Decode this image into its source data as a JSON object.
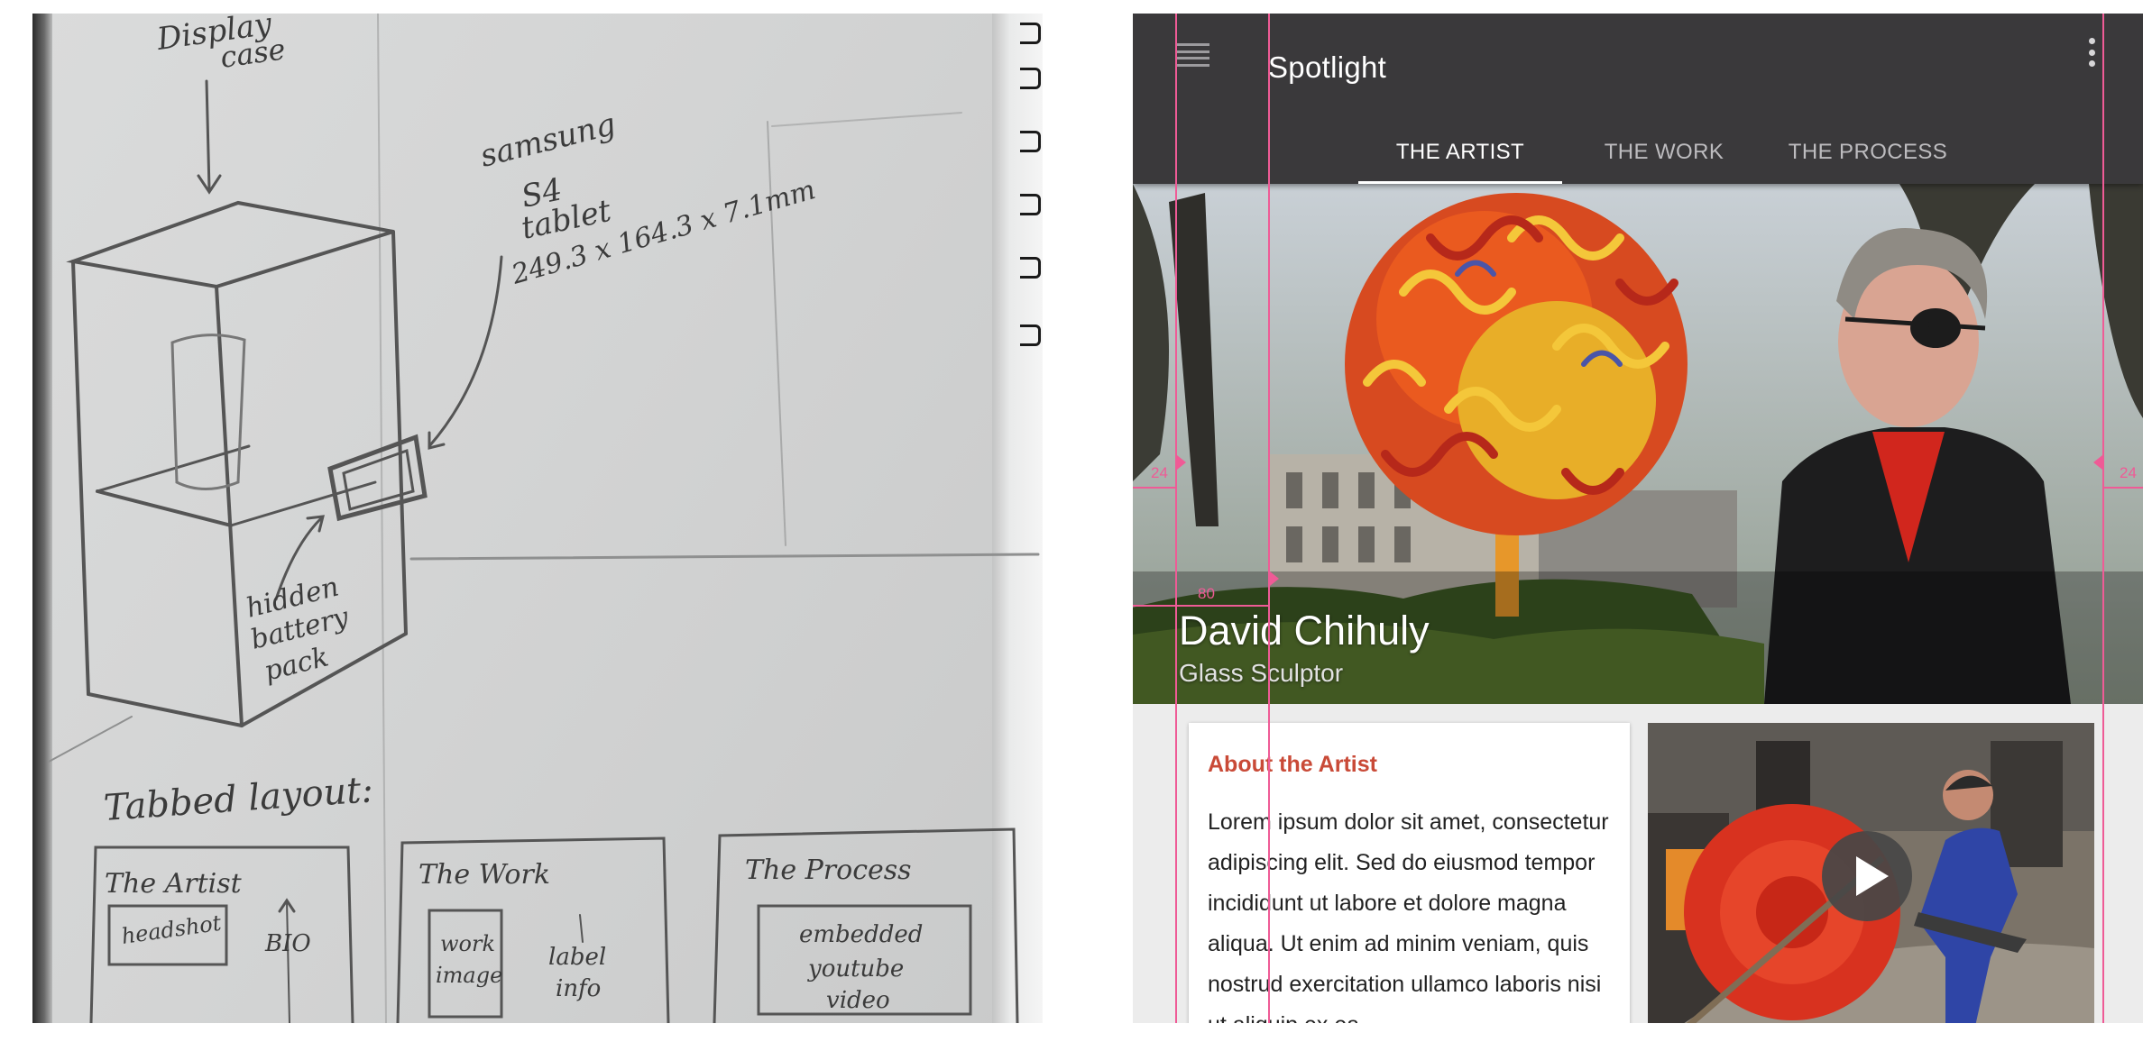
{
  "sketch": {
    "annotations": {
      "display_case_1": "Display",
      "display_case_2": "case",
      "tablet_1": "samsung",
      "tablet_2": "S4",
      "tablet_3": "tablet",
      "tablet_dims": "249.3 x 164.3 x 7.1mm",
      "battery_1": "hidden",
      "battery_2": "battery",
      "battery_3": "pack",
      "tabbed_layout": "Tabbed layout:"
    },
    "wireframes": [
      {
        "heading": "The Artist",
        "box": "headshot",
        "note": "BIO"
      },
      {
        "heading": "The Work",
        "box_1": "work",
        "box_2": "image",
        "note_1": "label",
        "note_2": "info"
      },
      {
        "heading": "The Process",
        "box_1": "embedded",
        "box_2": "youtube",
        "box_3": "video"
      }
    ]
  },
  "app": {
    "title": "Spotlight",
    "icons": {
      "menu": "menu-icon",
      "overflow": "more-vert-icon",
      "play": "play-icon"
    },
    "tabs": [
      {
        "label": "THE ARTIST",
        "active": true
      },
      {
        "label": "THE WORK",
        "active": false
      },
      {
        "label": "THE PROCESS",
        "active": false
      }
    ],
    "hero": {
      "name": "David Chihuly",
      "role": "Glass Sculptor"
    },
    "about": {
      "title": "About the Artist",
      "body": "Lorem ipsum dolor sit amet, consectetur adipiscing elit. Sed do eiusmod tempor incididunt ut labore et dolore magna aliqua. Ut enim ad minim veniam, quis nostrud exercitation ullamco laboris nisi ut aliquip ex ea"
    },
    "keylines": {
      "left_margin": "24",
      "right_margin": "24",
      "content_offset": "80"
    },
    "colors": {
      "appbar": "#3a393b",
      "accent": "#c94a37",
      "keyline": "#ef5b96",
      "tab_text": "#bdbcbf",
      "tab_active": "#ffffff"
    }
  }
}
